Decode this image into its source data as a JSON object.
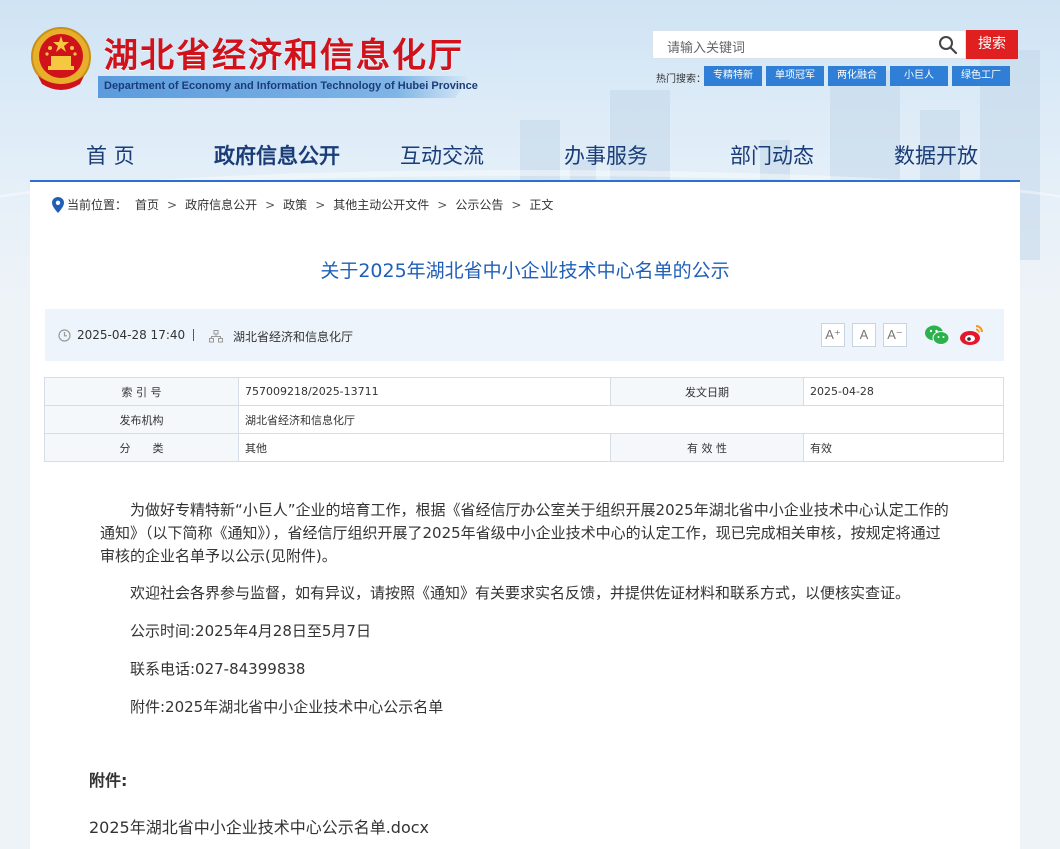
{
  "header": {
    "site_title": "湖北省经济和信息化厅",
    "site_subtitle": "Department of Economy and Information Technology of Hubei Province",
    "search_placeholder": "请输入关键词",
    "search_button": "搜索",
    "hot_label": "热门搜索：",
    "hot_tags": [
      "专精特新",
      "单项冠军",
      "两化融合",
      "小巨人",
      "绿色工厂"
    ]
  },
  "nav": {
    "items": [
      "首 页",
      "政府信息公开",
      "互动交流",
      "办事服务",
      "部门动态",
      "数据开放"
    ],
    "active_index": 1
  },
  "breadcrumb": {
    "prefix": "当前位置：",
    "items": [
      "首页",
      "政府信息公开",
      "政策",
      "其他主动公开文件",
      "公示公告",
      "正文"
    ]
  },
  "article": {
    "title": "关于2025年湖北省中小企业技术中心名单的公示",
    "date": "2025-04-28 17:40",
    "source": "湖北省经济和信息化厅",
    "font_sizes": [
      "A⁺",
      "A",
      "A⁻"
    ],
    "info": {
      "index_label": "索 引 号",
      "index_value": "757009218/2025-13711",
      "issue_date_label": "发文日期",
      "issue_date_value": "2025-04-28",
      "publisher_label": "发布机构",
      "publisher_value": "湖北省经济和信息化厅",
      "category_label": "分　　类",
      "category_value": "其他",
      "validity_label": "有 效 性",
      "validity_value": "有效"
    },
    "paragraphs": [
      "为做好专精特新“小巨人”企业的培育工作，根据《省经信厅办公室关于组织开展2025年湖北省中小企业技术中心认定工作的通知》（以下简称《通知》），省经信厅组织开展了2025年省级中小企业技术中心的认定工作，现已完成相关审核，按规定将通过审核的企业名单予以公示(见附件)。",
      "欢迎社会各界参与监督，如有异议，请按照《通知》有关要求实名反馈，并提供佐证材料和联系方式，以便核实查证。",
      "公示时间:2025年4月28日至5月7日",
      "联系电话:027-84399838",
      "附件:2025年湖北省中小企业技术中心公示名单"
    ],
    "attachment_heading": "附件:",
    "attachment_file": "2025年湖北省中小企业技术中心公示名单.docx"
  },
  "colors": {
    "brand_red": "#d0121b",
    "nav_blue": "#1a3d78",
    "title_blue": "#1f5fb8",
    "tag_blue": "#2f7fd6"
  }
}
